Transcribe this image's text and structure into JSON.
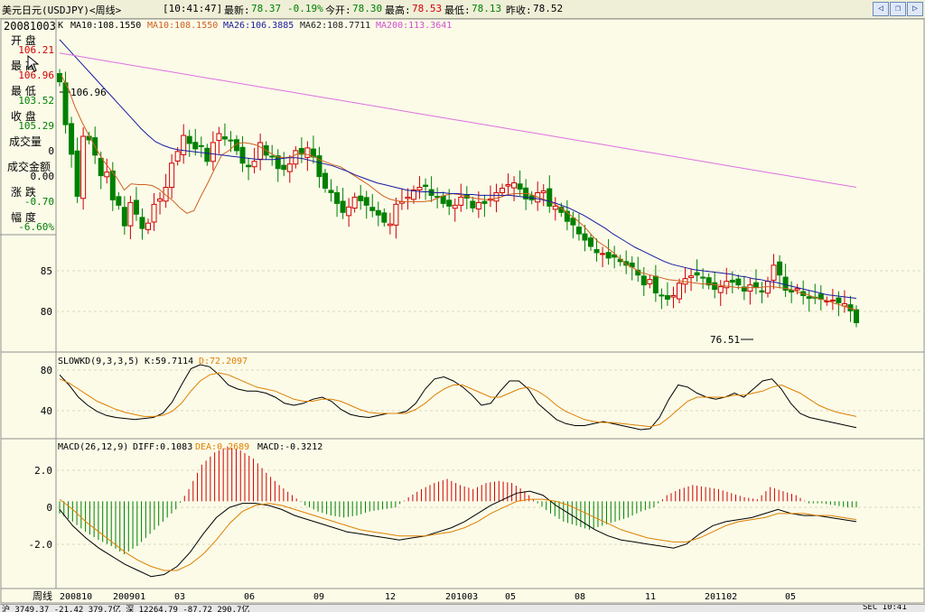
{
  "titlebar": {
    "title": "美元日元(USDJPY)<周线>",
    "time": "[10:41:47]",
    "latest_label": "最新:",
    "latest_value": "78.37",
    "change": "-0.19%",
    "open_label": "今开:",
    "open_value": "78.30",
    "high_label": "最高:",
    "high_value": "78.53",
    "low_label": "最低:",
    "low_value": "78.13",
    "prev_label": "昨收:",
    "prev_value": "78.52",
    "nav_buttons": [
      "left-arrow-icon",
      "restore-icon",
      "right-arrow-icon"
    ]
  },
  "info_panel": {
    "date": "20081003",
    "open_label": "开  盘",
    "open_value": "106.21",
    "high_label": "最  高",
    "high_value": "106.96",
    "low_label": "最  低",
    "low_value": "103.52",
    "close_label": "收  盘",
    "close_value": "105.29",
    "volume_label": "成交量",
    "volume_value": "0",
    "amount_label": "成交金额",
    "amount_value": "0.00",
    "change_label": "涨  跌",
    "change_value": "-0.70",
    "range_label": "幅  度",
    "range_value": "-6.60%"
  },
  "colors": {
    "up": "#d00000",
    "down": "#008000",
    "ma10": "#d06020",
    "ma26": "#1a1aa0",
    "ma62": "#202020",
    "ma200": "#e070e0",
    "k_line": "#000000",
    "d_line": "#e08000",
    "diff": "#000000",
    "dea": "#e08000"
  },
  "chart_data": [
    {
      "type": "candlestick",
      "legend": {
        "k": "K",
        "ma10": "MA10:108.1550",
        "ma10b": "MA10:108.1550",
        "ma26": "MA26:106.3885",
        "ma62": "MA62:108.7711",
        "ma200": "MA200:113.3641"
      },
      "y_ticks": [
        "85",
        "80"
      ],
      "ylim": [
        75.5,
        111
      ],
      "annotations": {
        "high_marker": "106.96",
        "low_marker": "76.51"
      },
      "series": {
        "close": [
          105.29,
          100.5,
          97.2,
          92.5,
          99.2,
          98.8,
          97.1,
          94.8,
          95.2,
          92.1,
          91.5,
          89.2,
          91.8,
          90.5,
          88.9,
          89.5,
          91.6,
          92.2,
          93.5,
          96.2,
          97.5,
          99.3,
          98.4,
          97.8,
          98.1,
          96.4,
          98.5,
          99.5,
          98.9,
          98.7,
          97.6,
          96.2,
          95.8,
          96.4,
          98.5,
          97.1,
          96.9,
          95.6,
          95.5,
          96.1,
          97.6,
          97.2,
          97.9,
          96.9,
          94.7,
          93.4,
          92.9,
          91.7,
          90.7,
          91.3,
          92.4,
          92.0,
          91.5,
          90.9,
          90.4,
          89.6,
          89.4,
          91.6,
          91.9,
          92.4,
          93.2,
          93.5,
          93.6,
          92.6,
          92.4,
          91.7,
          91.4,
          91.5,
          92.4,
          92.3,
          91.2,
          91.8,
          91.7,
          92.2,
          92.9,
          93.4,
          93.8,
          94.0,
          93.3,
          92.2,
          92.1,
          92.9,
          93.1,
          91.4,
          91.4,
          90.7,
          89.7,
          89.3,
          88.3,
          87.6,
          86.9,
          86.2,
          86.1,
          85.6,
          85.7,
          85.2,
          84.8,
          84.6,
          83.7,
          82.6,
          83.2,
          81.7,
          81.4,
          81.0,
          81.4,
          82.8,
          83.3,
          83.6,
          83.7,
          83.4,
          82.6,
          82.1,
          82.4,
          83.0,
          82.9,
          82.6,
          81.9,
          82.6,
          82.3,
          81.8,
          83.0,
          84.8,
          83.7,
          82.0,
          81.8,
          82.2,
          81.4,
          81.1,
          81.2,
          81.0,
          80.8,
          80.9,
          80.6,
          80.5,
          79.7,
          78.37
        ],
        "ma10": [
          106.0,
          104.5,
          102.4,
          100.7,
          99.2,
          97.8,
          96.5,
          95.5,
          94.5,
          93.2,
          93.9,
          93.8,
          93.8,
          93.7,
          93.3,
          92.6,
          92.0,
          91.2,
          90.6,
          90.9,
          92.5,
          94.0,
          95.6,
          97.1,
          97.6,
          98.3,
          98.5,
          98.4,
          98.2,
          97.8,
          97.3,
          96.9,
          96.8,
          96.9,
          97.3,
          97.2,
          97.0,
          96.6,
          96.3,
          96.0,
          95.8,
          95.3,
          94.8,
          94.3,
          93.8,
          93.2,
          92.6,
          92.2,
          92.0,
          91.9,
          91.9,
          91.9,
          91.9,
          92.0,
          92.3,
          92.6,
          92.8,
          92.7,
          92.5,
          92.3,
          92.2,
          92.1,
          92.2,
          92.4,
          92.7,
          92.8,
          92.8,
          92.8,
          92.5,
          92.2,
          91.9,
          91.5,
          91.0,
          90.4,
          89.8,
          89.1,
          88.2,
          87.4,
          86.9,
          86.3,
          85.6,
          84.9,
          84.5,
          84.0,
          83.8,
          83.6,
          83.4,
          83.2,
          83.1,
          83.0,
          82.9,
          82.8,
          82.7,
          82.7,
          82.6,
          82.5,
          82.4,
          82.3,
          82.3,
          82.3,
          82.3,
          82.4,
          82.4,
          82.3,
          82.2,
          82.0,
          81.7,
          81.5,
          81.2,
          81.0,
          80.8,
          80.5,
          80.3,
          80.0,
          79.8
        ],
        "ma26": [
          110.0,
          109.1,
          108.2,
          107.3,
          106.4,
          105.5,
          104.6,
          103.7,
          102.8,
          101.9,
          101.0,
          100.1,
          99.3,
          98.6,
          98.2,
          97.9,
          97.7,
          97.6,
          97.5,
          97.4,
          97.3,
          97.2,
          97.1,
          97.0,
          96.9,
          96.8,
          96.7,
          96.6,
          96.6,
          96.6,
          96.7,
          96.8,
          96.8,
          96.7,
          96.5,
          96.3,
          96.1,
          95.9,
          95.6,
          95.3,
          94.9,
          94.6,
          94.3,
          94.0,
          93.8,
          93.6,
          93.4,
          93.2,
          93.1,
          93.0,
          93.0,
          92.9,
          92.9,
          92.8,
          92.8,
          92.7,
          92.7,
          92.6,
          92.6,
          92.6,
          92.6,
          92.6,
          92.5,
          92.4,
          92.3,
          92.2,
          92.0,
          91.8,
          91.5,
          91.2,
          90.8,
          90.4,
          89.9,
          89.4,
          88.9,
          88.3,
          87.8,
          87.3,
          86.8,
          86.4,
          86.0,
          85.6,
          85.2,
          84.9,
          84.7,
          84.5,
          84.3,
          84.2,
          84.1,
          84.0,
          83.9,
          83.8,
          83.6,
          83.5,
          83.3,
          83.2,
          83.0,
          82.9,
          82.7,
          82.5,
          82.3,
          82.1,
          81.9,
          81.7,
          81.5,
          81.4,
          81.3,
          81.2,
          81.1
        ],
        "ma200": [
          108.5,
          108.3,
          108.1,
          107.9,
          107.7,
          107.5,
          107.3,
          107.1,
          106.9,
          106.7,
          106.5,
          106.3,
          106.1,
          105.9,
          105.7,
          105.5,
          105.3,
          105.1,
          104.9,
          104.7,
          104.5,
          104.3,
          104.1,
          103.9,
          103.7,
          103.5,
          103.3,
          103.1,
          102.9,
          102.7,
          102.5,
          102.3,
          102.1,
          101.9,
          101.7,
          101.5,
          101.3,
          101.1,
          100.9,
          100.7,
          100.5,
          100.3,
          100.1,
          99.9,
          99.7,
          99.5,
          99.3,
          99.1,
          98.9,
          98.7,
          98.5,
          98.3,
          98.1,
          97.9,
          97.7,
          97.5,
          97.3,
          97.1,
          96.9,
          96.7,
          96.5,
          96.3,
          96.1,
          95.9,
          95.7,
          95.5,
          95.3,
          95.1,
          94.9,
          94.7,
          94.5,
          94.3,
          94.1,
          93.9,
          93.7,
          93.5
        ]
      }
    },
    {
      "type": "line",
      "legend": {
        "name": "SLOWKD(9,3,3,5)",
        "k": "K:59.7114",
        "d": "D:72.2097"
      },
      "y_ticks": [
        "80",
        "40"
      ],
      "ylim": [
        10,
        90
      ],
      "series": [
        {
          "name": "K",
          "values": [
            72,
            62,
            50,
            42,
            36,
            32,
            30,
            29,
            28,
            29,
            30,
            34,
            45,
            62,
            78,
            82,
            80,
            72,
            62,
            58,
            56,
            56,
            54,
            50,
            44,
            42,
            44,
            48,
            50,
            46,
            38,
            33,
            31,
            30,
            32,
            34,
            34,
            36,
            44,
            58,
            68,
            70,
            66,
            60,
            52,
            42,
            44,
            56,
            66,
            66,
            58,
            44,
            36,
            28,
            24,
            22,
            22,
            24,
            26,
            24,
            22,
            20,
            18,
            19,
            30,
            48,
            62,
            60,
            54,
            50,
            48,
            50,
            54,
            50,
            58,
            66,
            68,
            58,
            44,
            34,
            30,
            28,
            26,
            24,
            22,
            20
          ]
        },
        {
          "name": "D",
          "values": [
            68,
            64,
            58,
            52,
            46,
            42,
            38,
            35,
            33,
            31,
            31,
            32,
            36,
            44,
            56,
            66,
            72,
            74,
            72,
            68,
            64,
            60,
            58,
            56,
            52,
            48,
            46,
            46,
            48,
            48,
            46,
            42,
            38,
            35,
            34,
            34,
            34,
            34,
            38,
            44,
            52,
            58,
            62,
            62,
            58,
            54,
            50,
            50,
            54,
            58,
            60,
            56,
            50,
            42,
            36,
            32,
            28,
            26,
            25,
            25,
            24,
            23,
            22,
            21,
            23,
            30,
            38,
            46,
            50,
            50,
            50,
            50,
            52,
            52,
            54,
            56,
            60,
            62,
            58,
            54,
            48,
            42,
            38,
            35,
            33,
            31
          ]
        }
      ]
    },
    {
      "type": "line",
      "legend": {
        "name": "MACD(26,12,9)",
        "diff": "DIFF:0.1083",
        "dea": "DEA:0.2689",
        "macd": "MACD:-0.3212"
      },
      "y_ticks": [
        "2.0",
        "0",
        "-2.0"
      ],
      "ylim": [
        -4.2,
        2.9
      ],
      "series": [
        {
          "name": "DIFF",
          "values": [
            -0.4,
            -1.2,
            -1.8,
            -2.3,
            -2.7,
            -3.1,
            -3.4,
            -3.7,
            -3.6,
            -3.2,
            -2.5,
            -1.6,
            -0.8,
            -0.3,
            -0.1,
            -0.1,
            -0.2,
            -0.4,
            -0.7,
            -0.9,
            -1.1,
            -1.3,
            -1.5,
            -1.6,
            -1.7,
            -1.8,
            -1.9,
            -1.8,
            -1.7,
            -1.5,
            -1.3,
            -1.0,
            -0.6,
            -0.2,
            0.1,
            0.4,
            0.5,
            0.3,
            -0.2,
            -0.6,
            -1.0,
            -1.4,
            -1.7,
            -1.9,
            -2.0,
            -2.1,
            -2.2,
            -2.3,
            -2.1,
            -1.6,
            -1.2,
            -1.0,
            -0.9,
            -0.8,
            -0.6,
            -0.4,
            -0.6,
            -0.7,
            -0.7,
            -0.8,
            -0.9,
            -1.0
          ]
        },
        {
          "name": "DEA",
          "values": [
            0.1,
            -0.4,
            -1.0,
            -1.5,
            -2.0,
            -2.5,
            -2.9,
            -3.2,
            -3.4,
            -3.4,
            -3.1,
            -2.6,
            -1.9,
            -1.1,
            -0.5,
            -0.2,
            -0.1,
            -0.2,
            -0.4,
            -0.6,
            -0.8,
            -1.0,
            -1.2,
            -1.4,
            -1.5,
            -1.6,
            -1.7,
            -1.7,
            -1.7,
            -1.6,
            -1.5,
            -1.3,
            -1.0,
            -0.6,
            -0.3,
            0.0,
            0.1,
            0.1,
            0.0,
            -0.2,
            -0.5,
            -0.8,
            -1.1,
            -1.4,
            -1.6,
            -1.8,
            -1.9,
            -2.0,
            -2.0,
            -1.8,
            -1.5,
            -1.2,
            -1.0,
            -0.9,
            -0.8,
            -0.6,
            -0.6,
            -0.6,
            -0.7,
            -0.7,
            -0.8,
            -0.9
          ]
        },
        {
          "name": "MACD",
          "values": [
            -0.6,
            -1.0,
            -1.5,
            -1.9,
            -2.2,
            -2.6,
            -2.2,
            -1.6,
            -1.0,
            -0.4,
            0.6,
            1.8,
            2.4,
            2.7,
            2.5,
            2.1,
            1.4,
            0.8,
            0.3,
            -0.2,
            -0.5,
            -0.7,
            -0.8,
            -0.7,
            -0.5,
            -0.4,
            -0.3,
            0.2,
            0.6,
            0.9,
            1.1,
            0.8,
            0.6,
            0.9,
            1.0,
            0.9,
            0.5,
            -0.1,
            -0.6,
            -1.0,
            -1.2,
            -1.4,
            -1.2,
            -1.0,
            -0.8,
            -0.5,
            -0.3,
            0.3,
            0.6,
            0.8,
            0.7,
            0.6,
            0.4,
            0.2,
            0.1,
            0.7,
            0.5,
            0.3,
            -0.1,
            -0.1,
            -0.2,
            -0.3
          ]
        }
      ]
    }
  ],
  "x_axis": {
    "period_label": "周线",
    "ticks": [
      "200810",
      "200901",
      "03",
      "06",
      "09",
      "12",
      "201003",
      "05",
      "08",
      "11",
      "201102",
      "05"
    ]
  },
  "status": {
    "left": "沪 3749.37  -21.42  379.7亿  深 12264.79  -87.72  290.7亿",
    "right": "SEC  10:41"
  }
}
